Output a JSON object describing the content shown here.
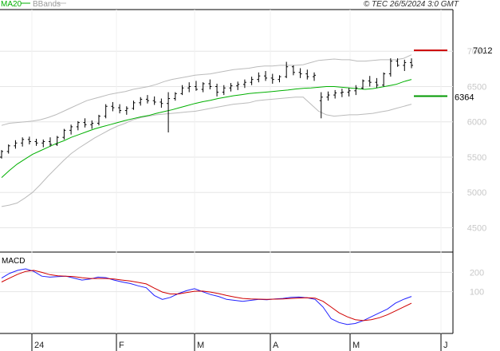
{
  "header": {
    "legend": [
      {
        "label": "MA20",
        "color": "#00b000"
      },
      {
        "label": "BBands",
        "color": "#bbbbbb"
      }
    ],
    "source": "© TEC 26/5/2024 3:0 GMT"
  },
  "chart_data": [
    {
      "type": "ohlc",
      "title": "",
      "ylim": [
        4200,
        7500
      ],
      "y_ticks": [
        7000,
        6500,
        6000,
        5500,
        5000,
        4500
      ],
      "x_ticks": [
        "24",
        "F",
        "M",
        "A",
        "M",
        "J"
      ],
      "colors": {
        "price": "#000000",
        "ma20": "#00b000",
        "bbands": "#bbbbbb",
        "resistance": "#cc0000",
        "support": "#009900"
      },
      "annotations": [
        {
          "label": "7012",
          "value": 7012,
          "color": "#cc0000"
        },
        {
          "label": "6364",
          "value": 6364,
          "color": "#009900"
        }
      ],
      "series": [
        {
          "name": "MA20",
          "values": [
            5210,
            5310,
            5400,
            5470,
            5540,
            5590,
            5640,
            5690,
            5730,
            5780,
            5820,
            5860,
            5900,
            5930,
            5960,
            5990,
            6020,
            6045,
            6070,
            6090,
            6120,
            6145,
            6170,
            6200,
            6230,
            6260,
            6285,
            6305,
            6330,
            6350,
            6370,
            6385,
            6400,
            6410,
            6420,
            6430,
            6440,
            6450,
            6465,
            6475,
            6480,
            6490,
            6500,
            6500,
            6490,
            6480,
            6470,
            6460,
            6470,
            6490,
            6510,
            6530,
            6570,
            6600
          ]
        },
        {
          "name": "BBands upper",
          "values": [
            5950,
            5980,
            5990,
            6000,
            6010,
            6030,
            6060,
            6100,
            6150,
            6200,
            6250,
            6300,
            6330,
            6360,
            6390,
            6410,
            6430,
            6460,
            6480,
            6500,
            6530,
            6570,
            6600,
            6620,
            6640,
            6660,
            6670,
            6680,
            6700,
            6720,
            6740,
            6750,
            6760,
            6780,
            6790,
            6790,
            6800,
            6800,
            6800,
            6810,
            6840,
            6870,
            6880,
            6890,
            6880,
            6880,
            6860,
            6860,
            6870,
            6880,
            6880,
            6880,
            6900,
            6950
          ]
        },
        {
          "name": "BBands lower",
          "values": [
            4800,
            4820,
            4850,
            4920,
            5000,
            5110,
            5230,
            5340,
            5450,
            5550,
            5630,
            5700,
            5770,
            5830,
            5890,
            5940,
            5980,
            6030,
            6060,
            6080,
            6100,
            6110,
            6120,
            6130,
            6140,
            6150,
            6170,
            6190,
            6210,
            6230,
            6250,
            6260,
            6270,
            6300,
            6310,
            6320,
            6330,
            6340,
            6350,
            6350,
            6250,
            6150,
            6100,
            6080,
            6090,
            6100,
            6100,
            6110,
            6120,
            6140,
            6160,
            6190,
            6220,
            6250
          ]
        }
      ],
      "ohlc": [
        [
          5500,
          5600,
          5480,
          5580
        ],
        [
          5580,
          5680,
          5550,
          5660
        ],
        [
          5660,
          5740,
          5620,
          5700
        ],
        [
          5700,
          5780,
          5650,
          5750
        ],
        [
          5750,
          5790,
          5680,
          5720
        ],
        [
          5720,
          5760,
          5660,
          5700
        ],
        [
          5700,
          5750,
          5640,
          5720
        ],
        [
          5720,
          5780,
          5650,
          5680
        ],
        [
          5680,
          5800,
          5660,
          5780
        ],
        [
          5780,
          5900,
          5750,
          5880
        ],
        [
          5880,
          5960,
          5820,
          5930
        ],
        [
          5930,
          6010,
          5880,
          5990
        ],
        [
          5990,
          6050,
          5920,
          5960
        ],
        [
          5960,
          6020,
          5900,
          5980
        ],
        [
          5980,
          6100,
          5950,
          6080
        ],
        [
          6080,
          6250,
          6050,
          6220
        ],
        [
          6220,
          6280,
          6150,
          6200
        ],
        [
          6200,
          6250,
          6120,
          6160
        ],
        [
          6160,
          6220,
          6100,
          6190
        ],
        [
          6190,
          6300,
          6170,
          6270
        ],
        [
          6270,
          6350,
          6230,
          6320
        ],
        [
          6320,
          6380,
          6260,
          6300
        ],
        [
          6300,
          6360,
          6240,
          6280
        ],
        [
          6280,
          6330,
          6200,
          6260
        ],
        [
          6260,
          6420,
          5850,
          6330
        ],
        [
          6330,
          6420,
          6300,
          6400
        ],
        [
          6400,
          6520,
          6380,
          6480
        ],
        [
          6480,
          6560,
          6420,
          6500
        ],
        [
          6500,
          6580,
          6440,
          6460
        ],
        [
          6460,
          6560,
          6420,
          6540
        ],
        [
          6540,
          6600,
          6460,
          6500
        ],
        [
          6500,
          6540,
          6360,
          6420
        ],
        [
          6420,
          6520,
          6380,
          6480
        ],
        [
          6480,
          6550,
          6430,
          6510
        ],
        [
          6510,
          6570,
          6450,
          6530
        ],
        [
          6530,
          6600,
          6480,
          6560
        ],
        [
          6560,
          6640,
          6520,
          6600
        ],
        [
          6600,
          6700,
          6560,
          6650
        ],
        [
          6650,
          6720,
          6580,
          6620
        ],
        [
          6620,
          6680,
          6540,
          6600
        ],
        [
          6600,
          6660,
          6560,
          6640
        ],
        [
          6640,
          6850,
          6620,
          6780
        ],
        [
          6780,
          6800,
          6660,
          6700
        ],
        [
          6700,
          6760,
          6620,
          6680
        ],
        [
          6680,
          6740,
          6600,
          6640
        ],
        [
          6640,
          6700,
          6580,
          6660
        ],
        [
          6300,
          6420,
          6050,
          6350
        ],
        [
          6350,
          6430,
          6300,
          6380
        ],
        [
          6380,
          6450,
          6330,
          6410
        ],
        [
          6410,
          6470,
          6350,
          6420
        ],
        [
          6420,
          6480,
          6360,
          6440
        ],
        [
          6440,
          6520,
          6380,
          6480
        ],
        [
          6480,
          6600,
          6460,
          6580
        ],
        [
          6580,
          6650,
          6500,
          6560
        ],
        [
          6560,
          6620,
          6480,
          6520
        ],
        [
          6520,
          6700,
          6500,
          6680
        ],
        [
          6680,
          6900,
          6640,
          6860
        ],
        [
          6860,
          6900,
          6780,
          6800
        ],
        [
          6800,
          6880,
          6720,
          6840
        ],
        [
          6840,
          6900,
          6760,
          6800
        ]
      ]
    },
    {
      "type": "line",
      "title": "MACD",
      "ylim": [
        -100,
        280
      ],
      "y_ticks": [
        200,
        100
      ],
      "series": [
        {
          "name": "MACD",
          "color": "#2020ff",
          "values": [
            170,
            195,
            210,
            218,
            205,
            180,
            175,
            178,
            180,
            170,
            160,
            165,
            175,
            172,
            160,
            150,
            142,
            130,
            120,
            80,
            60,
            70,
            90,
            105,
            115,
            100,
            85,
            75,
            60,
            55,
            50,
            55,
            60,
            58,
            62,
            65,
            70,
            72,
            68,
            60,
            20,
            -40,
            -60,
            -70,
            -65,
            -50,
            -30,
            -10,
            10,
            40,
            60,
            75
          ]
        },
        {
          "name": "Signal",
          "color": "#d00000",
          "values": [
            150,
            170,
            190,
            205,
            210,
            200,
            188,
            182,
            180,
            178,
            172,
            168,
            168,
            168,
            165,
            160,
            155,
            148,
            140,
            118,
            98,
            88,
            88,
            95,
            102,
            103,
            98,
            90,
            80,
            72,
            65,
            62,
            61,
            60,
            61,
            62,
            65,
            67,
            68,
            66,
            50,
            20,
            -10,
            -30,
            -45,
            -50,
            -45,
            -35,
            -20,
            0,
            20,
            40
          ]
        }
      ]
    }
  ]
}
